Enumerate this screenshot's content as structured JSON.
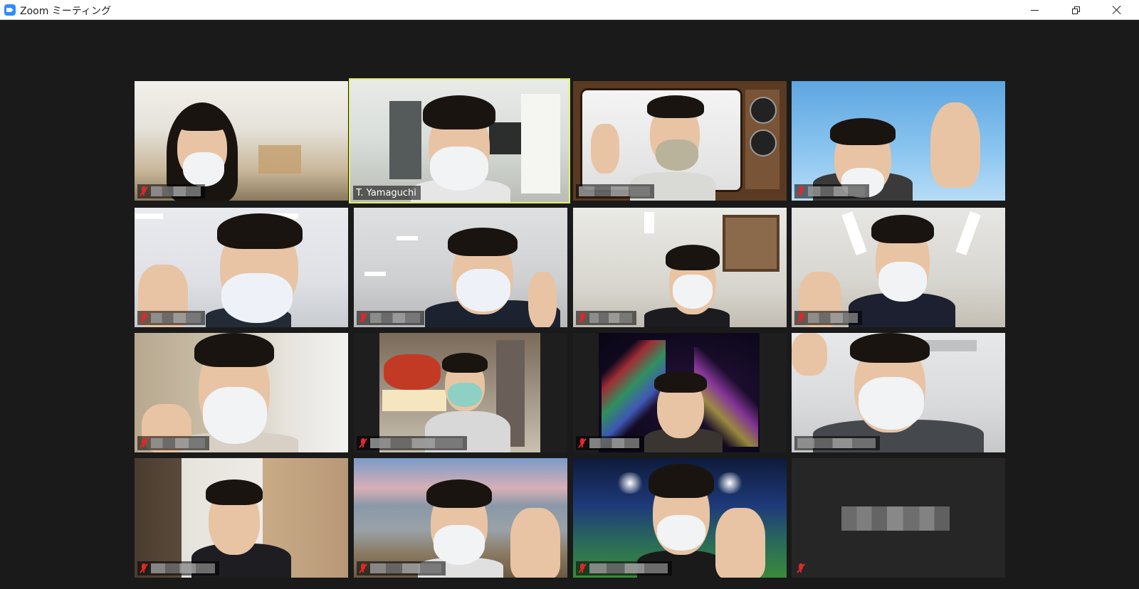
{
  "window": {
    "title": "Zoom ミーティング",
    "app_icon": "zoom-icon",
    "controls": [
      "minimize-icon",
      "restore-icon",
      "close-icon"
    ]
  },
  "gallery": {
    "rows": 4,
    "columns": 4,
    "tiles": [
      {
        "name": "",
        "muted": true,
        "video": true,
        "active": false
      },
      {
        "name": "T. Yamaguchi",
        "muted": false,
        "video": true,
        "active": true
      },
      {
        "name": "",
        "muted": false,
        "video": true,
        "active": false
      },
      {
        "name": "",
        "muted": true,
        "video": true,
        "active": false
      },
      {
        "name": "",
        "muted": true,
        "video": true,
        "active": false
      },
      {
        "name": "",
        "muted": true,
        "video": true,
        "active": false
      },
      {
        "name": "",
        "muted": true,
        "video": true,
        "active": false
      },
      {
        "name": "",
        "muted": true,
        "video": true,
        "active": false
      },
      {
        "name": "",
        "muted": true,
        "video": true,
        "active": false
      },
      {
        "name": "",
        "muted": true,
        "video": true,
        "active": false
      },
      {
        "name": "",
        "muted": true,
        "video": true,
        "active": false
      },
      {
        "name": "",
        "muted": false,
        "video": true,
        "active": false
      },
      {
        "name": "",
        "muted": true,
        "video": true,
        "active": false
      },
      {
        "name": "",
        "muted": true,
        "video": true,
        "active": false
      },
      {
        "name": "",
        "muted": true,
        "video": true,
        "active": false
      },
      {
        "name": "",
        "muted": true,
        "video": false,
        "active": false
      }
    ]
  },
  "colors": {
    "background": "#1a1a1a",
    "active_speaker_border": "#e4f06a",
    "muted_icon": "#e02828",
    "titlebar": "#ffffff"
  }
}
